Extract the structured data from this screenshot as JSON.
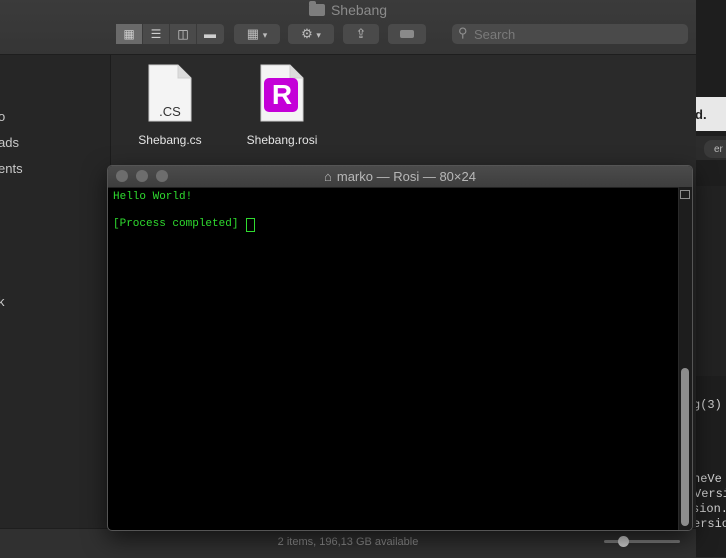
{
  "finder": {
    "title": "Shebang",
    "search_placeholder": "Search",
    "sidebar_items": [
      "o",
      "ads",
      "ents",
      "k"
    ],
    "files": [
      {
        "name": "Shebang.cs",
        "icon_label": ".CS"
      },
      {
        "name": "Shebang.rosi",
        "icon_label": "R"
      }
    ],
    "status": "2 items, 196,13 GB available",
    "icon_size_fraction": 0.25
  },
  "terminal": {
    "title": "marko — Rosi — 80×24",
    "lines": [
      "Hello World!",
      "",
      "[Process completed]"
    ]
  },
  "background_editor": {
    "tab_label": "d.",
    "tab2_label": "er",
    "code_lines": [
      "g(3)",
      "neVe",
      "Versi",
      "sion.",
      "ersio"
    ]
  },
  "colors": {
    "terminal_text": "#2fdc2f",
    "rosi_icon": "#c400d8"
  }
}
